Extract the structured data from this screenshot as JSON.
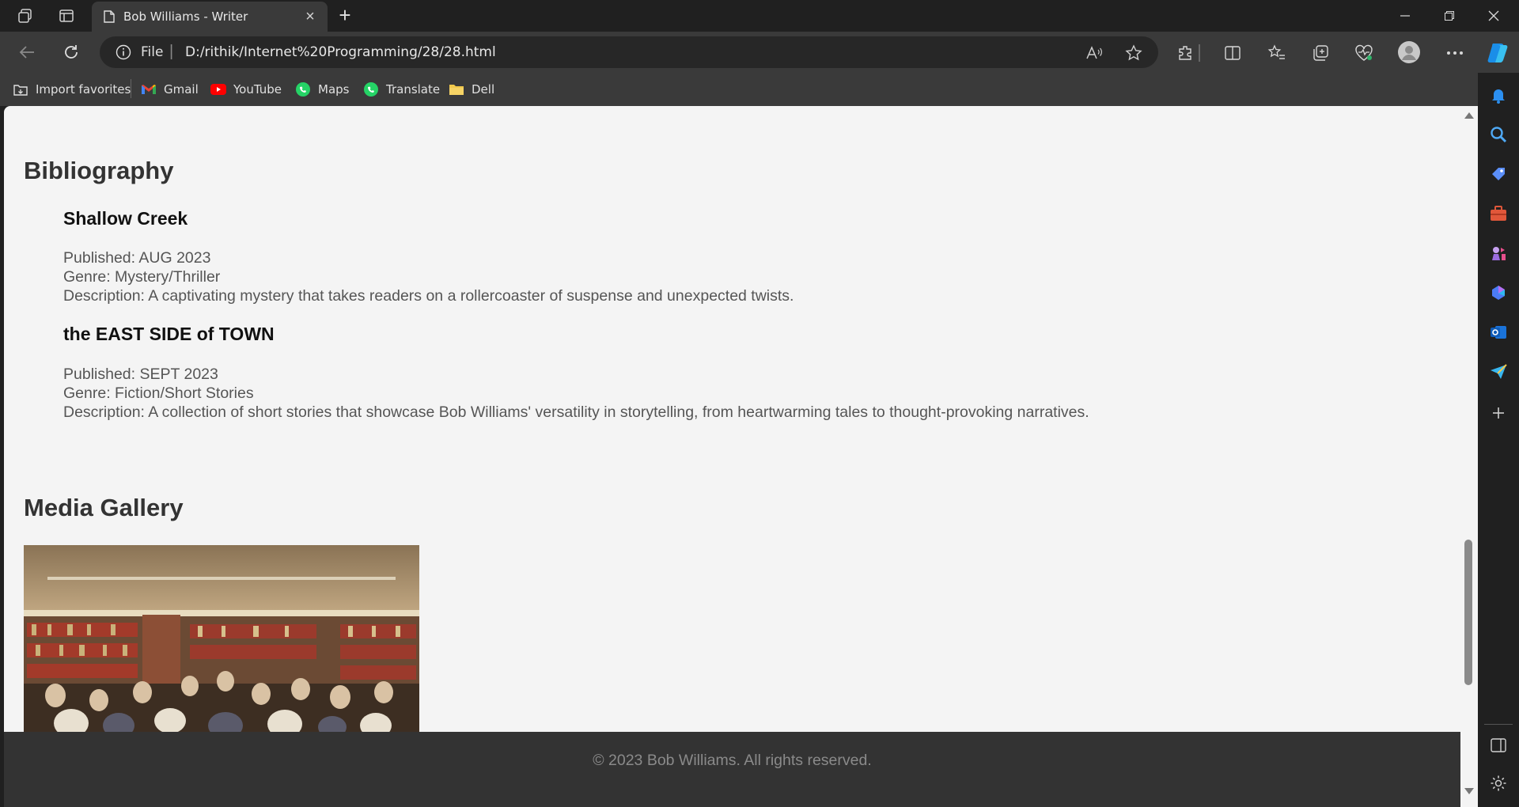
{
  "browser": {
    "tab_title": "Bob Williams - Writer",
    "address": {
      "scheme_label": "File",
      "url": "D:/rithik/Internet%20Programming/28/28.html"
    },
    "favorites": [
      {
        "label": "Import favorites",
        "icon": "import-icon"
      },
      {
        "label": "Gmail",
        "icon": "gmail-icon"
      },
      {
        "label": "YouTube",
        "icon": "youtube-icon"
      },
      {
        "label": "Maps",
        "icon": "whatsapp-icon"
      },
      {
        "label": "Translate",
        "icon": "translate-icon"
      },
      {
        "label": "Dell",
        "icon": "folder-icon"
      }
    ]
  },
  "page": {
    "bibliography": {
      "heading": "Bibliography",
      "books": [
        {
          "title": "Shallow Creek",
          "published": "Published: AUG 2023",
          "genre": "Genre: Mystery/Thriller",
          "description": "Description: A captivating mystery that takes readers on a rollercoaster of suspense and unexpected twists."
        },
        {
          "title": "the EAST SIDE of TOWN",
          "published": "Published: SEPT 2023",
          "genre": "Genre: Fiction/Short Stories",
          "description": "Description: A collection of short stories that showcase Bob Williams' versatility in storytelling, from heartwarming tales to thought-provoking narratives."
        }
      ]
    },
    "media_gallery": {
      "heading": "Media Gallery"
    },
    "footer": {
      "text": "© 2023 Bob Williams. All rights reserved."
    }
  }
}
